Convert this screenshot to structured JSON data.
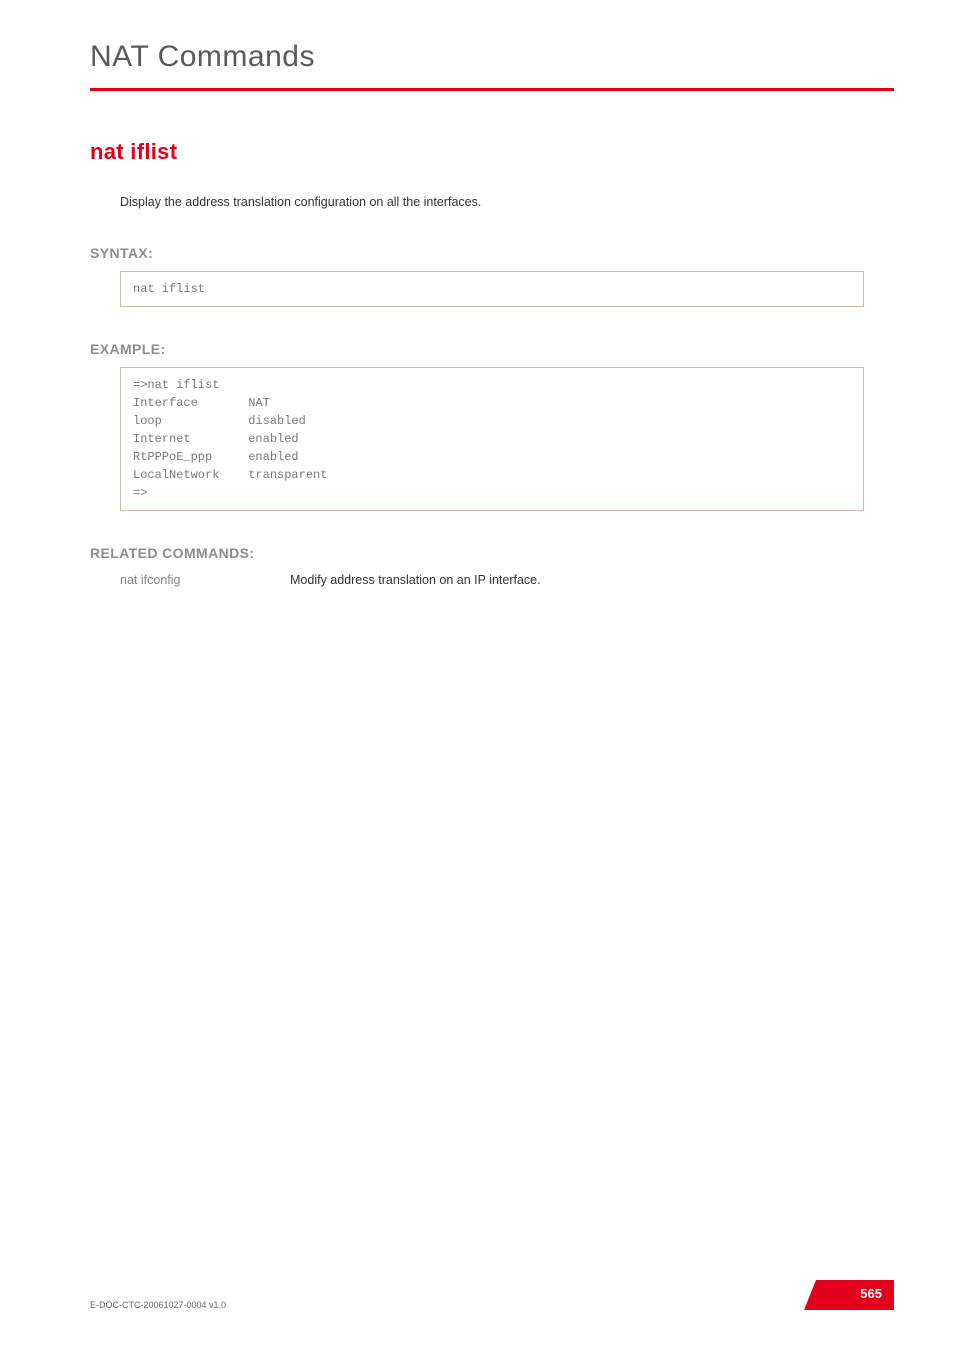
{
  "page_title": "NAT Commands",
  "command": {
    "title": "nat iflist",
    "description": "Display the address translation configuration on all the interfaces."
  },
  "syntax": {
    "heading": "SYNTAX:",
    "code": "nat iflist"
  },
  "example": {
    "heading": "EXAMPLE:",
    "code": "=>nat iflist\nInterface       NAT\nloop            disabled\nInternet        enabled\nRtPPPoE_ppp     enabled\nLocalNetwork    transparent\n=>"
  },
  "related": {
    "heading": "RELATED COMMANDS:",
    "rows": [
      {
        "cmd": "nat ifconfig",
        "desc": "Modify address translation on an IP interface."
      }
    ]
  },
  "footer": {
    "doc_id": "E-DOC-CTC-20061027-0004 v1.0",
    "page_number": "565"
  },
  "colors": {
    "accent": "#e2001a"
  }
}
